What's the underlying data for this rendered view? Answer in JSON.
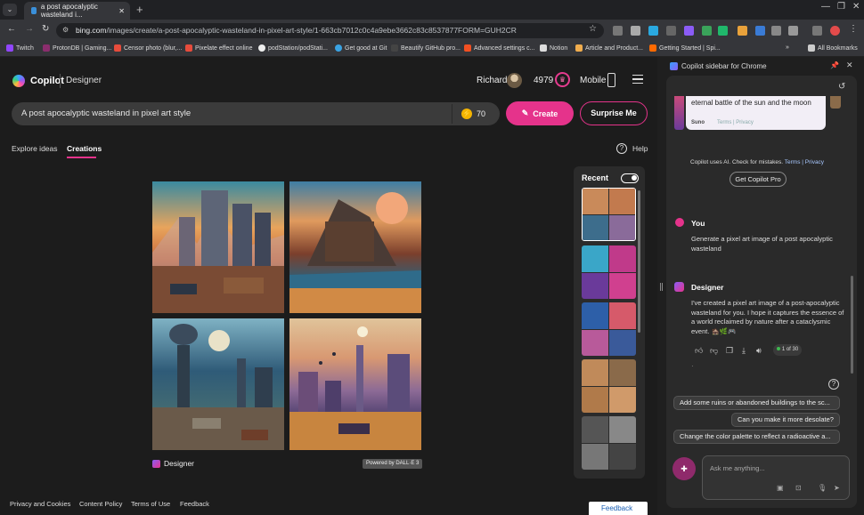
{
  "browser": {
    "tab_title": "a post apocalyptic wasteland i...",
    "url_host": "bing.com",
    "url_path": "/images/create/a-post-apocalyptic-wasteland-in-pixel-art-style/1-663cb7012c0c4a9ebe3662c83c8537877FORM=GUH2CR",
    "bookmarks": [
      "Twitch",
      "ProtonDB | Gaming...",
      "Censor photo (blur,...",
      "Pixelate effect online",
      "podStation/podStati...",
      "Get good at Git",
      "Beautify GitHub pro...",
      "Advanced settings c...",
      "Notion",
      "Article and Product...",
      "Getting Started | Spi...",
      "All Bookmarks"
    ],
    "bookmark_colors": [
      "#9146ff",
      "#8b2d6d",
      "#e74c3c",
      "#e74c3c",
      "#eee",
      "#3aa3e3",
      "#444",
      "#f25022",
      "#ddd",
      "#f0ad4e",
      "#ff6a00",
      "#ccc"
    ]
  },
  "header": {
    "brand": "Copilot",
    "product": "Designer",
    "user_name": "Richard",
    "points": "4979",
    "mobile_label": "Mobile"
  },
  "prompt": {
    "text": "A post apocalyptic wasteland in pixel art style",
    "boosts": "70",
    "create_label": "Create",
    "surprise_label": "Surprise Me"
  },
  "tabs": {
    "explore": "Explore ideas",
    "creations": "Creations",
    "help": "Help"
  },
  "result": {
    "designer_label": "Designer",
    "powered_by": "Powered by DALL·E 3"
  },
  "recent": {
    "label": "Recent"
  },
  "footer": {
    "privacy": "Privacy and Cookies",
    "content_policy": "Content Policy",
    "terms": "Terms of Use",
    "feedback": "Feedback",
    "feedback_button": "Feedback"
  },
  "sidebar": {
    "title": "Copilot sidebar for Chrome",
    "card_text": "eternal battle of the sun and the moon",
    "card_source": "Suno",
    "card_links": "Terms | Privacy",
    "disclaimer_prefix": "Copilot uses AI. Check for mistakes.",
    "disclaimer_links": "Terms | Privacy",
    "get_pro": "Get Copilot Pro",
    "you_label": "You",
    "you_message": "Generate a pixel art image of a post apocalyptic wasteland",
    "designer_label": "Designer",
    "designer_message": "I've created a pixel art image of a post-apocalyptic wasteland for you. I hope it captures the essence of a world reclaimed by nature after a cataclysmic event. 🏚️🌿🎮",
    "counter": "1 of 30",
    "suggestions": [
      "Add some ruins or abandoned buildings to the sc...",
      "Can you make it more desolate?",
      "Change the color palette to reflect a radioactive a..."
    ],
    "ask_placeholder": "Ask me anything..."
  }
}
